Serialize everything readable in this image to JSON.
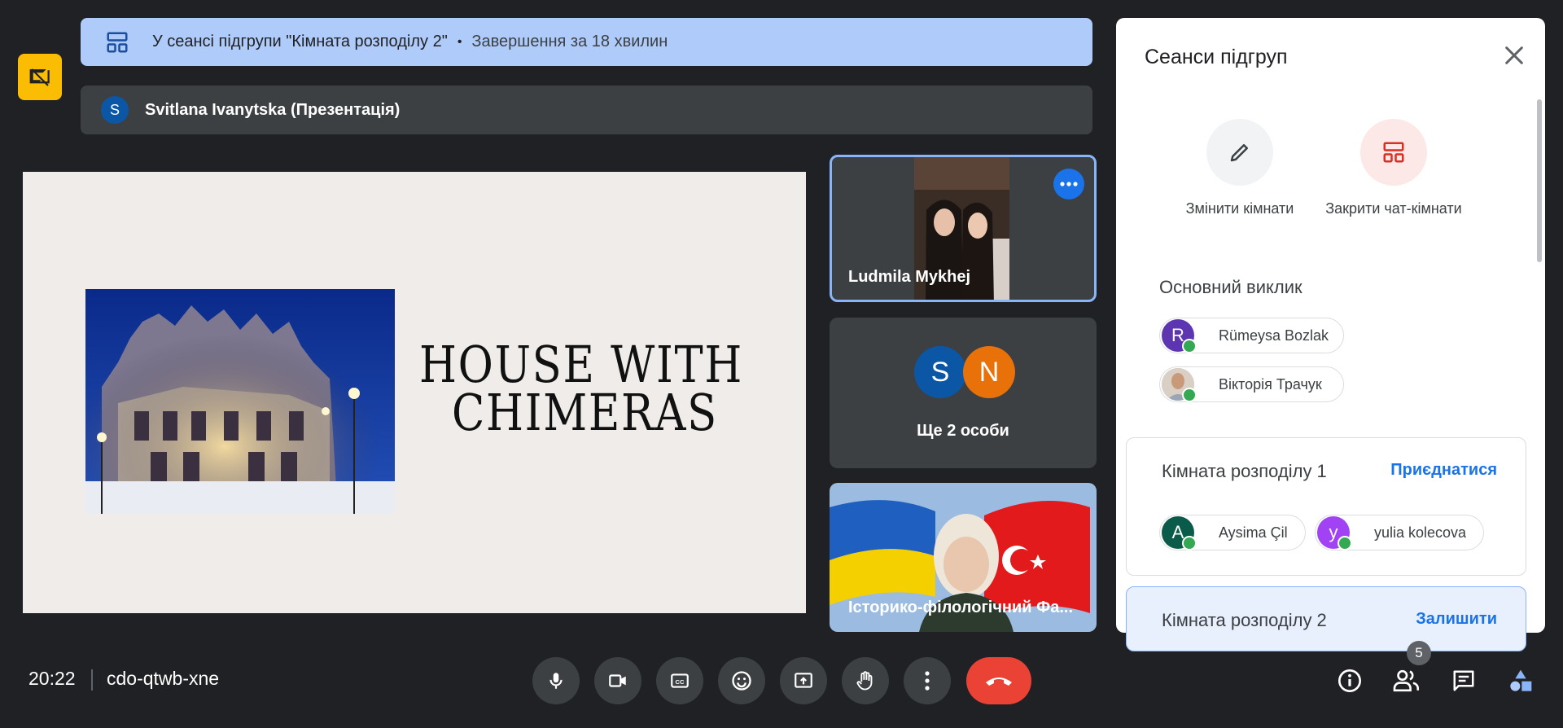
{
  "banner": {
    "text": "У сеансі підгрупи \"Кімната розподілу 2\"",
    "dot": "•",
    "ends": "Завершення за 18 хвилин"
  },
  "presenter": {
    "initial": "S",
    "label": "Svitlana Ivanytska (Презентація)"
  },
  "slide": {
    "title_line1": "HOUSE WITH",
    "title_line2": "CHIMERAS"
  },
  "tiles": {
    "tile1_name": "Ludmila Mykhej",
    "tile2_avatar1": "S",
    "tile2_avatar2": "N",
    "tile2_label": "Ще 2 особи",
    "tile3_name": "Історико-філологічний Фа..."
  },
  "panel": {
    "title": "Сеанси підгруп",
    "edit_rooms": "Змінити кімнати",
    "close_rooms": "Закрити чат-кімнати",
    "main_call": "Основний виклик",
    "main_participants": [
      {
        "initial": "R",
        "name": "Rümeysa Bozlak",
        "color": "#5e35b1"
      },
      {
        "initial": "",
        "name": "Вікторія Трачук",
        "color": "#c9b7a8"
      }
    ],
    "room1": {
      "name": "Кімната розподілу 1",
      "action": "Приєднатися",
      "participants": [
        {
          "initial": "A",
          "name": "Aysima Çil",
          "color": "#0b5b4a"
        },
        {
          "initial": "y",
          "name": "yulia kolecova",
          "color": "#a142f4"
        }
      ]
    },
    "room2": {
      "name": "Кімната розподілу 2",
      "action": "Залишити"
    }
  },
  "bottom": {
    "time": "20:22",
    "meeting_code": "cdo-qtwb-xne",
    "people_count": "5"
  },
  "colors": {
    "accent": "#1a73e8",
    "banner": "#aecbfa",
    "end_call": "#ea4335",
    "online": "#34a853"
  }
}
